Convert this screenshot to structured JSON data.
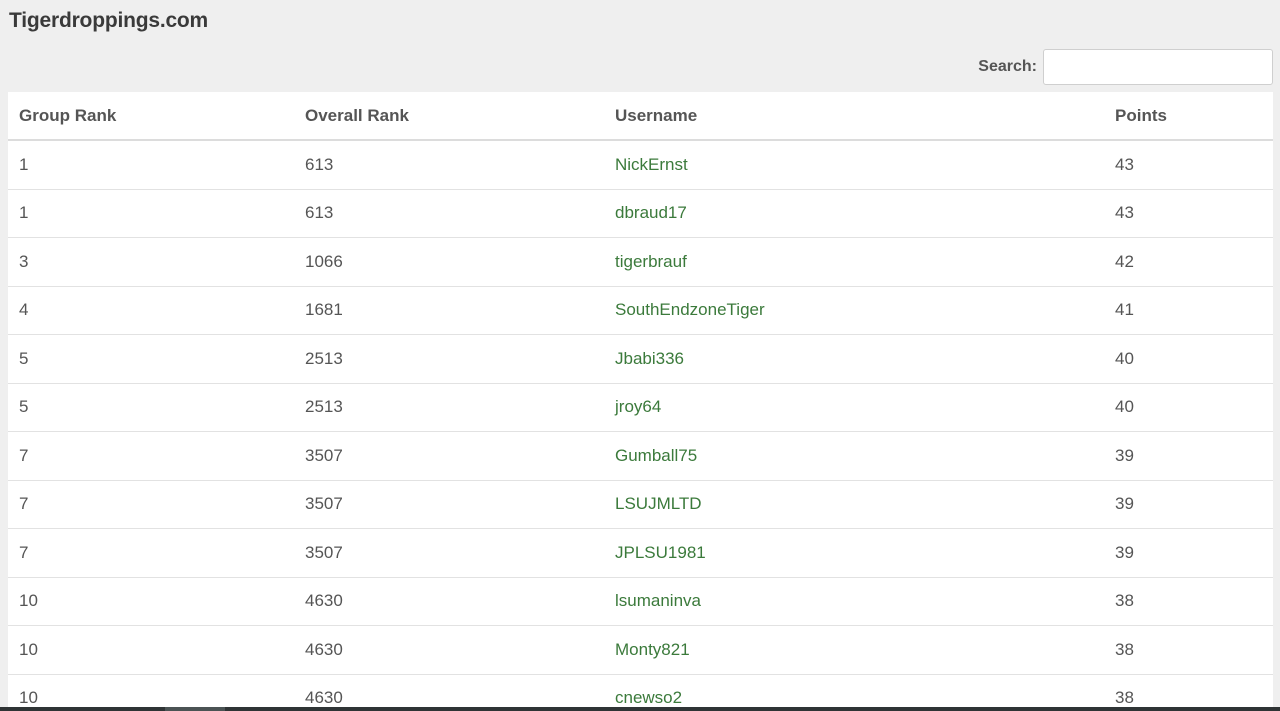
{
  "header": {
    "site_title": "Tigerdroppings.com"
  },
  "search": {
    "label": "Search:",
    "value": "",
    "placeholder": ""
  },
  "table": {
    "columns": [
      "Group Rank",
      "Overall Rank",
      "Username",
      "Points"
    ],
    "rows": [
      {
        "group_rank": "1",
        "overall_rank": "613",
        "username": "NickErnst",
        "points": "43"
      },
      {
        "group_rank": "1",
        "overall_rank": "613",
        "username": "dbraud17",
        "points": "43"
      },
      {
        "group_rank": "3",
        "overall_rank": "1066",
        "username": "tigerbrauf",
        "points": "42"
      },
      {
        "group_rank": "4",
        "overall_rank": "1681",
        "username": "SouthEndzoneTiger",
        "points": "41"
      },
      {
        "group_rank": "5",
        "overall_rank": "2513",
        "username": "Jbabi336",
        "points": "40"
      },
      {
        "group_rank": "5",
        "overall_rank": "2513",
        "username": "jroy64",
        "points": "40"
      },
      {
        "group_rank": "7",
        "overall_rank": "3507",
        "username": "Gumball75",
        "points": "39"
      },
      {
        "group_rank": "7",
        "overall_rank": "3507",
        "username": "LSUJMLTD",
        "points": "39"
      },
      {
        "group_rank": "7",
        "overall_rank": "3507",
        "username": "JPLSU1981",
        "points": "39"
      },
      {
        "group_rank": "10",
        "overall_rank": "4630",
        "username": "lsumaninva",
        "points": "38"
      },
      {
        "group_rank": "10",
        "overall_rank": "4630",
        "username": "Monty821",
        "points": "38"
      },
      {
        "group_rank": "10",
        "overall_rank": "4630",
        "username": "cnewso2",
        "points": "38"
      }
    ]
  },
  "colors": {
    "background": "#efefef",
    "username_link": "#3b7a3b",
    "text": "#555555"
  }
}
